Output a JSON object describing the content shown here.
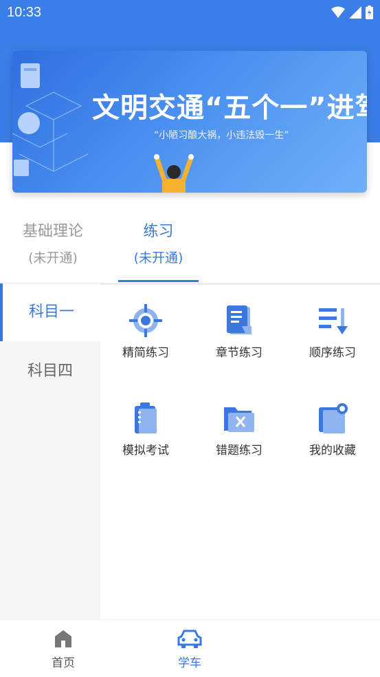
{
  "status": {
    "time": "10:33"
  },
  "banner": {
    "title": "文明交通“五个一”进驾校",
    "subtitle": "“小陋习酿大祸，小违法毁一生”"
  },
  "tabs": [
    {
      "label": "基础理论",
      "sub": "(未开通)"
    },
    {
      "label": "练习",
      "sub": "(未开通)"
    }
  ],
  "sidebar": {
    "items": [
      {
        "label": "科目一"
      },
      {
        "label": "科目四"
      }
    ]
  },
  "grid": {
    "items": [
      {
        "label": "精简练习",
        "icon": "target-icon"
      },
      {
        "label": "章节练习",
        "icon": "document-icon"
      },
      {
        "label": "顺序练习",
        "icon": "sort-list-icon"
      },
      {
        "label": "模拟考试",
        "icon": "clipboard-icon"
      },
      {
        "label": "错题练习",
        "icon": "folder-x-icon"
      },
      {
        "label": "我的收藏",
        "icon": "bookmark-icon"
      }
    ]
  },
  "nav": {
    "items": [
      {
        "label": "首页",
        "icon": "home-icon"
      },
      {
        "label": "学车",
        "icon": "car-icon"
      }
    ]
  },
  "colors": {
    "accent": "#3a78e0",
    "header": "#3b7ee8",
    "icon_light": "#8fb4f0"
  }
}
